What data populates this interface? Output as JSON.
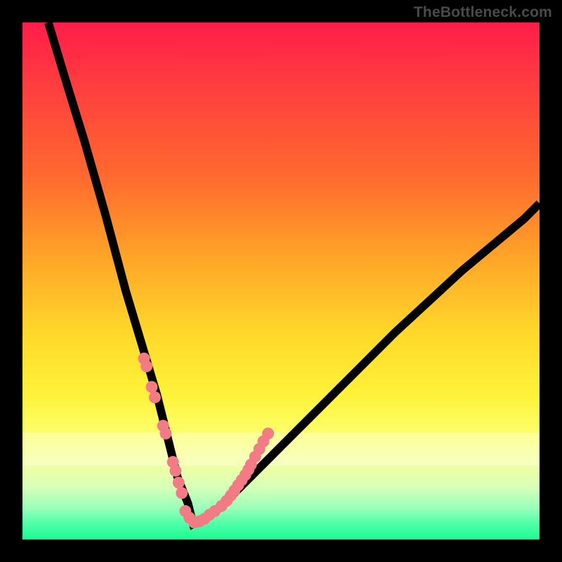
{
  "watermark": "TheBottleneck.com",
  "chart_data": {
    "type": "line",
    "title": "",
    "xlabel": "",
    "ylabel": "",
    "xlim": [
      0,
      100
    ],
    "ylim": [
      0,
      100
    ],
    "grid": false,
    "legend": false,
    "note": "Axes are unlabeled; values are pixel-normalized 0–100 (left/bottom = 0). Curve is a V-shaped bottleneck curve with minimum near x≈33, y≈3. Salmon dots cluster along the lower part of both arms near the trough.",
    "series": [
      {
        "name": "curve",
        "x": [
          5,
          8,
          12,
          16,
          20,
          23,
          26,
          28,
          30,
          32,
          33,
          35,
          38,
          42,
          50,
          60,
          72,
          85,
          97,
          100
        ],
        "y": [
          100,
          90,
          77,
          63,
          48,
          38,
          28,
          20,
          12,
          7,
          3,
          4,
          6,
          10,
          18,
          28,
          40,
          52,
          62,
          65
        ]
      },
      {
        "name": "dots-left-arm",
        "x": [
          23.5,
          24.0,
          25.0,
          25.6,
          27.2,
          27.7,
          29.1,
          29.6,
          30.2,
          30.8
        ],
        "y": [
          35.0,
          33.5,
          29.5,
          27.5,
          22.0,
          20.5,
          15.0,
          13.3,
          11.0,
          9.0
        ]
      },
      {
        "name": "dots-trough",
        "x": [
          31.5,
          32.3,
          33.2,
          34.2,
          35.2,
          36.2,
          37.2
        ],
        "y": [
          5.5,
          4.2,
          3.3,
          3.5,
          4.0,
          4.8,
          5.5
        ]
      },
      {
        "name": "dots-right-arm",
        "x": [
          38.5,
          39.5,
          40.3,
          41.0,
          41.7,
          42.4,
          43.1,
          43.7,
          44.2,
          45.0,
          45.8,
          46.6,
          47.5
        ],
        "y": [
          6.5,
          7.5,
          8.5,
          9.5,
          10.5,
          11.5,
          12.5,
          13.5,
          14.5,
          16.0,
          17.5,
          19.0,
          20.5
        ]
      }
    ],
    "bands": [
      {
        "name": "pale-band",
        "y0": 14.2,
        "y1": 20.7
      }
    ],
    "background_gradient": {
      "direction": "vertical",
      "stops": [
        {
          "pos": 0.0,
          "color": "#ff1d4a"
        },
        {
          "pos": 0.3,
          "color": "#ff6a2f"
        },
        {
          "pos": 0.6,
          "color": "#ffd82a"
        },
        {
          "pos": 0.8,
          "color": "#fcff6e"
        },
        {
          "pos": 0.94,
          "color": "#98ffb9"
        },
        {
          "pos": 1.0,
          "color": "#1dfc90"
        }
      ]
    }
  }
}
